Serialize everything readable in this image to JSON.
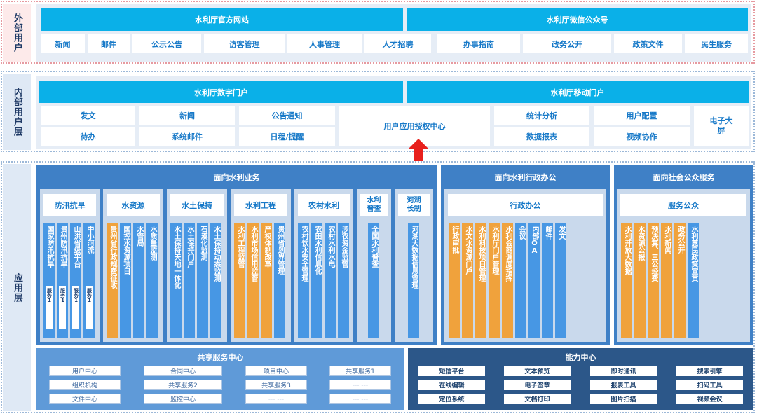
{
  "layers": {
    "external": "外部用户",
    "internal": "内部用户层",
    "application": "应用层"
  },
  "external": {
    "website": "水利厅官方网站",
    "wechat": "水利厅微信公众号",
    "website_items": [
      "新闻",
      "邮件",
      "公示公告",
      "访客管理",
      "人事管理",
      "人才招聘"
    ],
    "wechat_items": [
      "办事指南",
      "政务公开",
      "政策文件",
      "民生服务"
    ]
  },
  "internal": {
    "portal": "水利厅数字门户",
    "mobile": "水利厅移动门户",
    "left_items": [
      "发文",
      "新闻",
      "公告通知",
      "待办",
      "系统邮件",
      "日程/提醒"
    ],
    "auth_center": "用户应用授权中心",
    "right_items": [
      "统计分析",
      "用户配置",
      "数据报表",
      "视频协作"
    ],
    "screen": "电子大屏"
  },
  "app": {
    "water_business": {
      "title": "面向水利业务",
      "groups": [
        {
          "name": "防汛抗旱",
          "items": [
            "国家防汛抗旱",
            "贵州防汛抗旱",
            "山洪省级平台",
            "中小河流"
          ],
          "minis": [
            "服务1",
            "服务1",
            "服务1",
            "服务1"
          ]
        },
        {
          "name": "水资源",
          "items": [
            "贵州省行政规费征收",
            "国控水资源项目",
            "水管局",
            "水质量监测"
          ]
        },
        {
          "name": "水土保持",
          "items": [
            "水土保持天地一体化",
            "水土保持门户",
            "石漠化监测",
            "水土保持动态监测"
          ]
        },
        {
          "name": "水利工程",
          "items": [
            "水利工程监管",
            "水利市场信用监管",
            "产权体制改革",
            "贵州省划界管理"
          ]
        },
        {
          "name": "农村水利",
          "items": [
            "农村饮水安全管理",
            "农田水利信息化",
            "农村水利水电",
            "涉农资金监管"
          ]
        },
        {
          "name": "水利普查",
          "items": [
            "全国水利普查"
          ]
        },
        {
          "name": "河湖长制",
          "items": [
            "河湖大数据信息管理"
          ]
        }
      ]
    },
    "admin": {
      "title": "面向水利行政办公",
      "header": "行政办公",
      "items": [
        "行政审批",
        "水文水资源门户",
        "水利科技项目管理",
        "水利厅门户管理",
        "水利会商调度指挥",
        "会议",
        "内部OA",
        "邮件",
        "发文"
      ]
    },
    "public": {
      "title": "面向社会公众服务",
      "header": "服务公众",
      "items": [
        "水利开放大数据",
        "水资源公报",
        "预决算、三公经费",
        "水利新闻",
        "政务公开",
        "水利惠民政策宣贯"
      ]
    },
    "shared": {
      "title": "共享服务中心",
      "cells": [
        "用户中心",
        "合同中心",
        "项目中心",
        "共享服务1",
        "组织机构",
        "共享服务2",
        "共享服务3",
        "--- ---",
        "文件中心",
        "监控中心",
        "--- ---",
        "--- ---"
      ]
    },
    "ability": {
      "title": "能力中心",
      "cells": [
        "短信平台",
        "文本预览",
        "即时通讯",
        "搜索引擎",
        "在线编辑",
        "电子签章",
        "报表工具",
        "扫码工具",
        "定位系统",
        "文档打印",
        "图片扫描",
        "视频会议"
      ]
    }
  },
  "colors": {
    "cyan": "#0ab0e8",
    "deep_blue": "#3f80c6",
    "dark_navy": "#2c5789",
    "orange": "#f0a23c",
    "arrow_red": "#e8201c",
    "external_bg": "#fdeaea",
    "internal_bg": "#dfe9f5"
  },
  "icons": [
    "up-arrow-icon"
  ]
}
